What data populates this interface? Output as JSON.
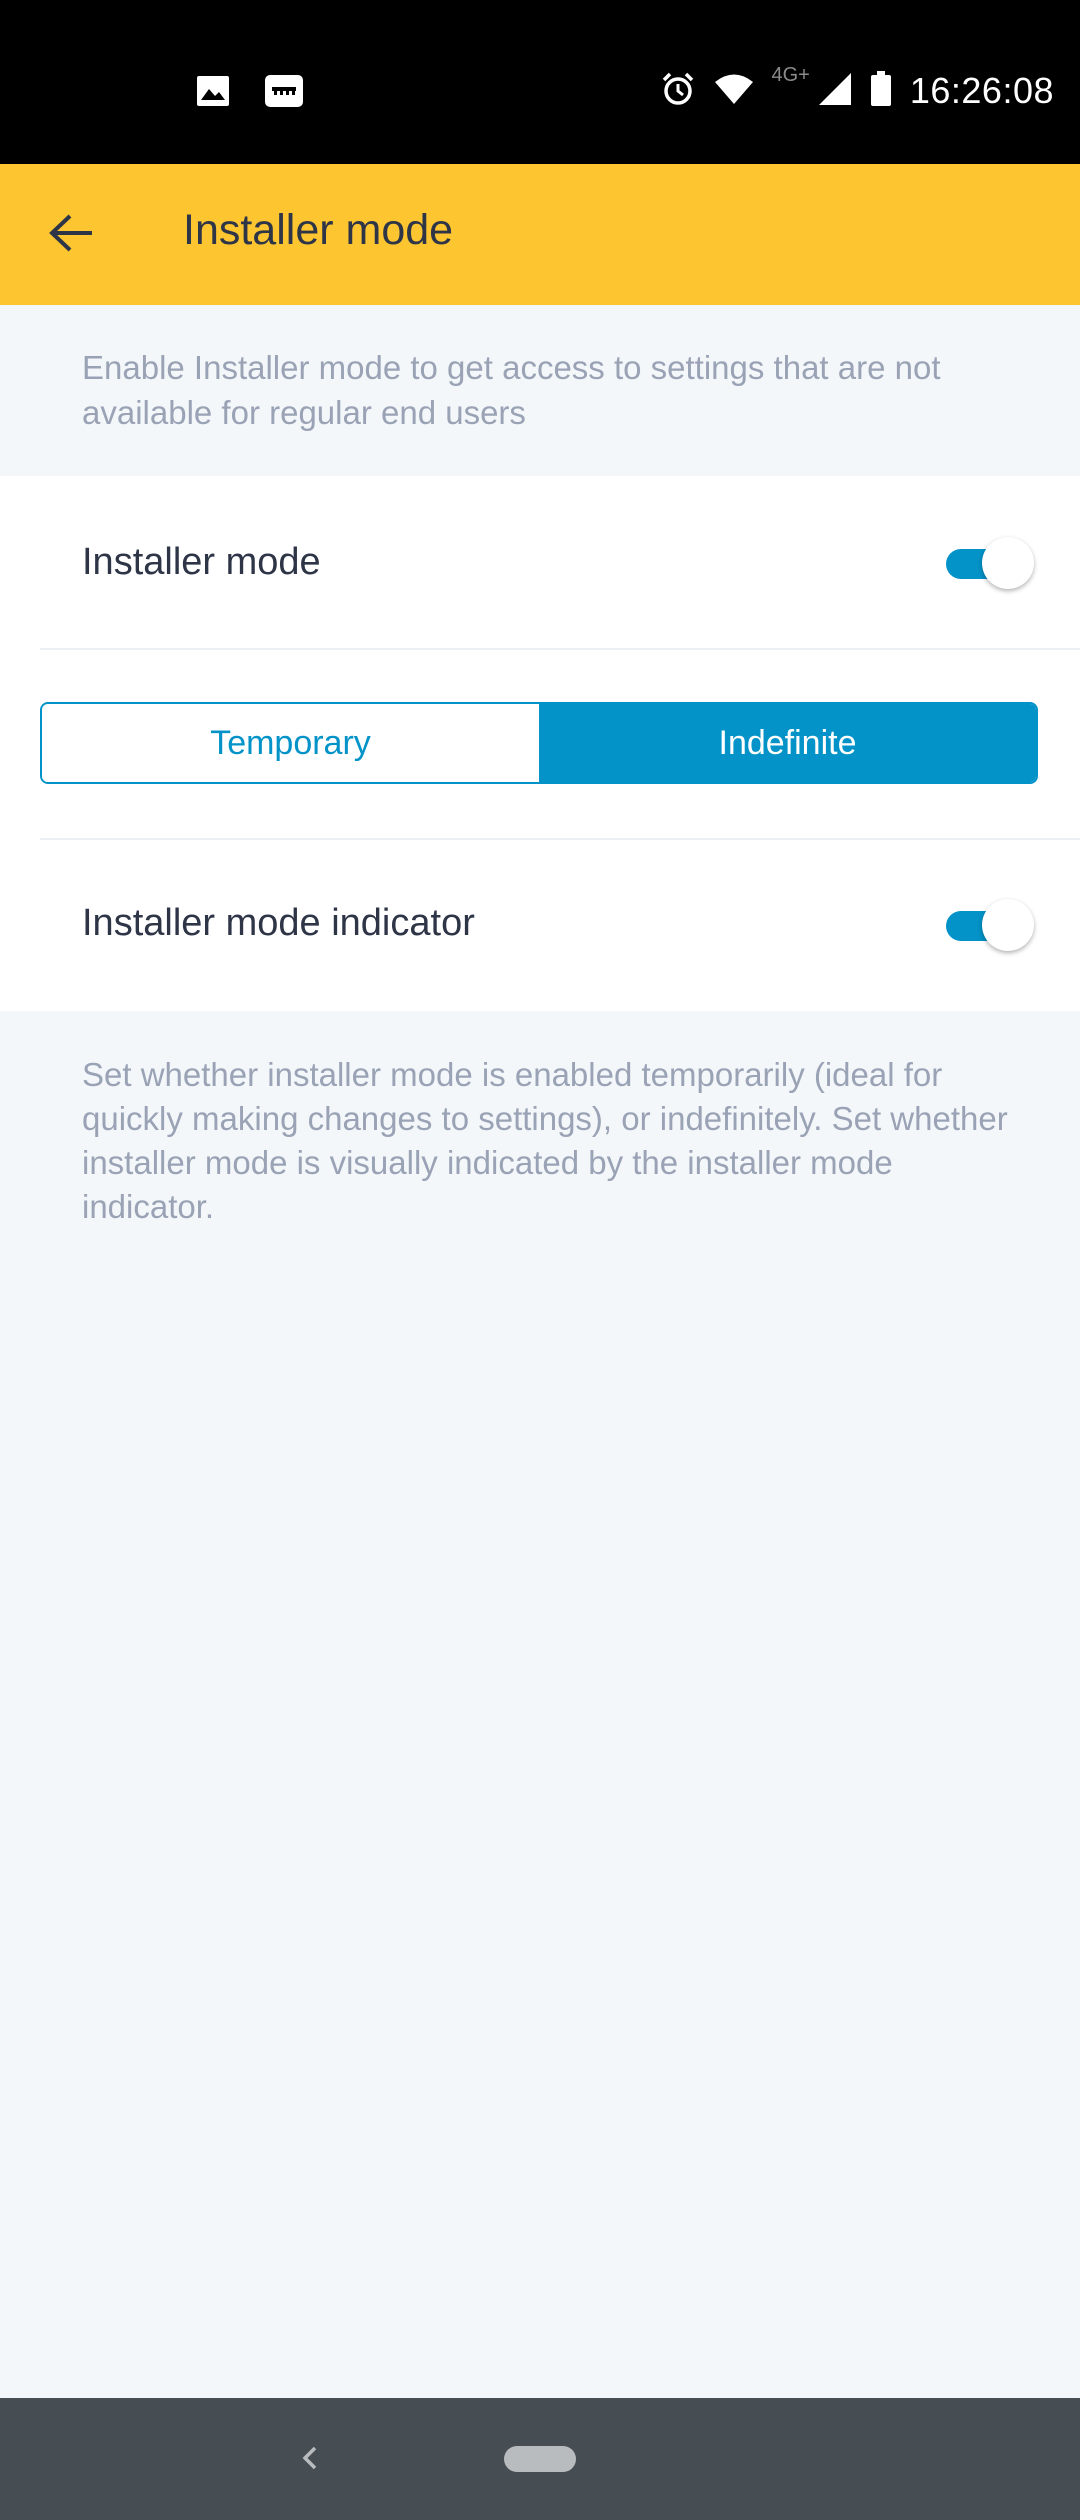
{
  "status_bar": {
    "time": "16:26:08",
    "network": "4G+",
    "left_icons": [
      "image-icon",
      "sd-card-icon"
    ],
    "right_icons": [
      "alarm-icon",
      "wifi-icon",
      "signal-icon",
      "battery-icon"
    ]
  },
  "app_bar": {
    "title": "Installer mode",
    "back_icon": "arrow-left-icon"
  },
  "intro": {
    "text": "Enable Installer mode to get access to settings that are not available for regular end users"
  },
  "settings": {
    "installer_mode": {
      "label": "Installer mode",
      "enabled": true
    },
    "duration": {
      "options": [
        "Temporary",
        "Indefinite"
      ],
      "selected": "Indefinite"
    },
    "indicator": {
      "label": "Installer mode indicator",
      "enabled": true
    }
  },
  "help": {
    "text": "Set whether installer mode is enabled temporarily (ideal for quickly making changes to settings), or indefinitely. Set whether installer mode is visually indicated by the installer mode indicator."
  },
  "colors": {
    "accent": "#0393c8",
    "app_bar": "#fdc630",
    "background": "#f4f7fa",
    "nav_bar": "#464d53"
  }
}
